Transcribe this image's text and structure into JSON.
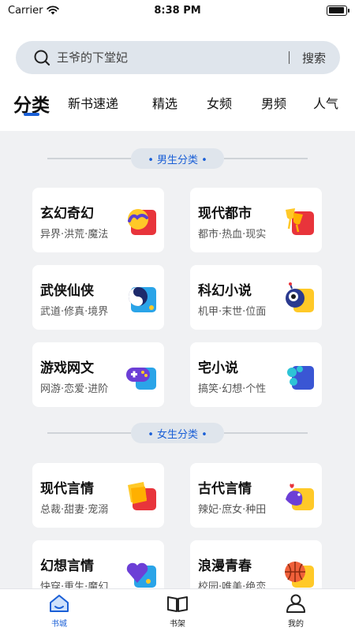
{
  "status_bar": {
    "carrier": "Carrier",
    "time": "8:38 PM",
    "battery_level": 0.95
  },
  "search": {
    "placeholder": "王爷的下堂妃",
    "button_label": "搜索"
  },
  "tabs": [
    {
      "label": "分类",
      "active": true
    },
    {
      "label": "新书速递",
      "active": false
    },
    {
      "label": "精选",
      "active": false
    },
    {
      "label": "女频",
      "active": false
    },
    {
      "label": "男频",
      "active": false
    },
    {
      "label": "人气",
      "active": false
    }
  ],
  "sections": [
    {
      "title": "• 男生分类 •",
      "items": [
        {
          "title": "玄幻奇幻",
          "sub": "异界·洪荒·魔法",
          "icon": "fantasy-moon-icon"
        },
        {
          "title": "现代都市",
          "sub": "都市·热血·现实",
          "icon": "city-cheers-icon"
        },
        {
          "title": "武侠仙侠",
          "sub": "武道·修真·境界",
          "icon": "yin-yang-icon"
        },
        {
          "title": "科幻小说",
          "sub": "机甲·末世·位面",
          "icon": "alien-icon"
        },
        {
          "title": "游戏网文",
          "sub": "网游·恋爱·进阶",
          "icon": "gamepad-icon"
        },
        {
          "title": "宅小说",
          "sub": "搞笑·幻想·个性",
          "icon": "bubbles-icon"
        }
      ]
    },
    {
      "title": "• 女生分类 •",
      "items": [
        {
          "title": "现代言情",
          "sub": "总裁·甜妻·宠溺",
          "icon": "book-pages-icon"
        },
        {
          "title": "古代言情",
          "sub": "辣妃·庶女·种田",
          "icon": "bird-icon"
        },
        {
          "title": "幻想言情",
          "sub": "快穿·重生·魔幻",
          "icon": "heart-icon"
        },
        {
          "title": "浪漫青春",
          "sub": "校园·唯美·绝恋",
          "icon": "basketball-icon"
        }
      ]
    }
  ],
  "bottom_nav": [
    {
      "label": "书城",
      "icon": "home-icon",
      "active": true
    },
    {
      "label": "书架",
      "icon": "open-book-icon",
      "active": false
    },
    {
      "label": "我的",
      "icon": "profile-icon",
      "active": false
    }
  ],
  "colors": {
    "accent": "#1a5fd6",
    "search_bg": "#dfe5ec",
    "content_bg": "#f0f1f3"
  }
}
